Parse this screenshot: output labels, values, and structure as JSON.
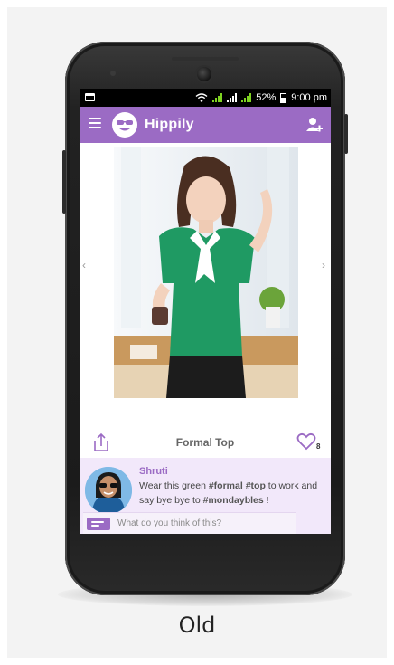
{
  "status_bar": {
    "battery_percent": "52%",
    "time": "9:00 pm",
    "signal_color": "#7ed321"
  },
  "app_bar": {
    "title": "Hippily",
    "menu_icon": "hamburger-icon",
    "logo_icon": "smiley-sunglasses-logo",
    "action_icon": "add-user-icon",
    "color": "#9b6bc4"
  },
  "post": {
    "caption": "Formal Top",
    "like_count": "8",
    "share_icon": "share-icon",
    "like_icon": "heart-icon"
  },
  "comment": {
    "user": "Shruti",
    "text_1": "Wear this green ",
    "tag_1": "#formal",
    "tag_2": "#top",
    "text_2": " to work and say bye bye to ",
    "tag_3": "#mondaybles",
    "text_3": " !"
  },
  "comment_input": {
    "placeholder": "What do you think of this?"
  },
  "footer": {
    "label": "Old"
  }
}
